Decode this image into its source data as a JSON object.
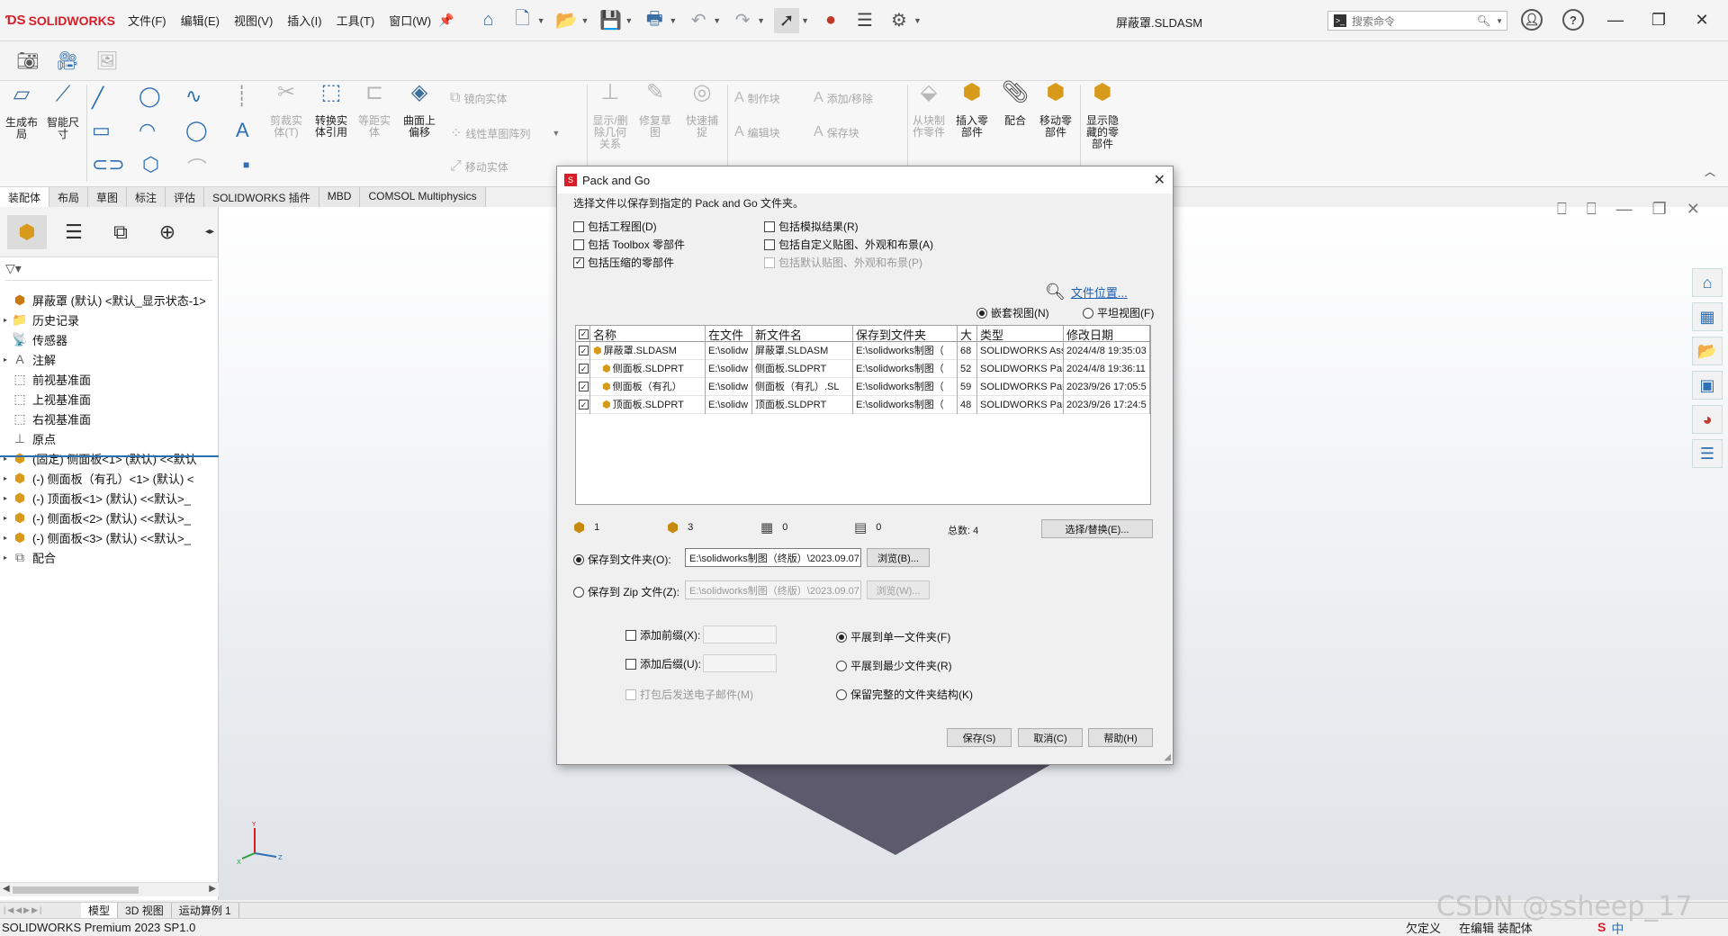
{
  "app": {
    "logo_text": "SOLIDWORKS",
    "document_title": "屏蔽罩.SLDASM",
    "brand_color": "#d71e28",
    "accent_color": "#2f6fb3"
  },
  "menu": [
    "文件(F)",
    "编辑(E)",
    "视图(V)",
    "插入(I)",
    "工具(T)",
    "窗口(W)"
  ],
  "search": {
    "placeholder": "搜索命令"
  },
  "ribbon": {
    "buttons": {
      "generate_layout": "生成布局",
      "smart_dim": "智能尺寸",
      "cut_entity": "剪裁实体(T)",
      "convert": "转换实体引用",
      "offset": "等距实体",
      "surface_offset": "曲面上偏移",
      "show_delete": "显示/删除几何关系",
      "repair_sketch": "修复草图",
      "quick_snap": "快速捕捉",
      "from_block": "从块制作零件",
      "insert_part": "插入零部件",
      "mate": "配合",
      "move_part": "移动零部件",
      "show_hidden": "显示隐藏的零部件"
    },
    "small": {
      "mirror": "镜向实体",
      "linear_pattern": "线性草图阵列",
      "move_entity": "移动实体",
      "make_block": "制作块",
      "edit_block": "编辑块",
      "add_remove": "添加/移除",
      "save_block": "保存块"
    }
  },
  "command_tabs": [
    "装配体",
    "布局",
    "草图",
    "标注",
    "评估",
    "SOLIDWORKS 插件",
    "MBD",
    "COMSOL Multiphysics"
  ],
  "tree": {
    "root": "屏蔽罩 (默认) <默认_显示状态-1>",
    "items": [
      {
        "label": "历史记录",
        "exp": true,
        "icon": "history-icon"
      },
      {
        "label": "传感器",
        "exp": false,
        "icon": "sensor-icon"
      },
      {
        "label": "注解",
        "exp": true,
        "icon": "annotation-icon"
      },
      {
        "label": "前视基准面",
        "exp": false,
        "icon": "plane-icon"
      },
      {
        "label": "上视基准面",
        "exp": false,
        "icon": "plane-icon"
      },
      {
        "label": "右视基准面",
        "exp": false,
        "icon": "plane-icon"
      },
      {
        "label": "原点",
        "exp": false,
        "icon": "origin-icon"
      },
      {
        "label": "(固定) 侧面板<1> (默认) <<默认",
        "exp": true,
        "icon": "part-icon"
      },
      {
        "label": "(-) 侧面板（有孔）<1> (默认) <",
        "exp": true,
        "icon": "part-icon"
      },
      {
        "label": "(-) 顶面板<1> (默认) <<默认>_",
        "exp": true,
        "icon": "part-icon"
      },
      {
        "label": "(-) 侧面板<2> (默认) <<默认>_",
        "exp": true,
        "icon": "part-icon"
      },
      {
        "label": "(-) 侧面板<3> (默认) <<默认>_",
        "exp": true,
        "icon": "part-icon"
      },
      {
        "label": "配合",
        "exp": true,
        "icon": "mate-icon"
      }
    ]
  },
  "dialog": {
    "title": "Pack and Go",
    "description": "选择文件以保存到指定的 Pack and Go 文件夹。",
    "options": {
      "include_drawings": {
        "label": "包括工程图(D)",
        "checked": false
      },
      "include_sim": {
        "label": "包括模拟结果(R)",
        "checked": false
      },
      "include_toolbox": {
        "label": "包括 Toolbox 零部件",
        "checked": false
      },
      "include_custom_decals": {
        "label": "包括自定义贴图、外观和布景(A)",
        "checked": false
      },
      "include_suppressed": {
        "label": "包括压缩的零部件",
        "checked": true
      },
      "include_default_decals": {
        "label": "包括默认贴图、外观和布景(P)",
        "checked": false
      }
    },
    "file_location_link": "文件位置...",
    "view_nested": "嵌套视图(N)",
    "view_flat": "平坦视图(F)",
    "table": {
      "headers": [
        "名称",
        "在文件",
        "新文件名",
        "保存到文件夹",
        "大",
        "类型",
        "修改日期"
      ],
      "rows": [
        {
          "name": "屏蔽罩.SLDASM",
          "in": "E:\\solidw",
          "newname": "屏蔽罩.SLDASM",
          "folder": "E:\\solidworks制图（",
          "size": "68",
          "type": "SOLIDWORKS Ass",
          "date": "2024/4/8 19:35:03",
          "indent": 0
        },
        {
          "name": "侧面板.SLDPRT",
          "in": "E:\\solidw",
          "newname": "侧面板.SLDPRT",
          "folder": "E:\\solidworks制图（",
          "size": "52",
          "type": "SOLIDWORKS Part",
          "date": "2024/4/8 19:36:11",
          "indent": 1
        },
        {
          "name": "侧面板（有孔）",
          "in": "E:\\solidw",
          "newname": "侧面板（有孔）.SL",
          "folder": "E:\\solidworks制图（",
          "size": "59",
          "type": "SOLIDWORKS Part",
          "date": "2023/9/26 17:05:5",
          "indent": 1
        },
        {
          "name": "顶面板.SLDPRT",
          "in": "E:\\solidw",
          "newname": "顶面板.SLDPRT",
          "folder": "E:\\solidworks制图（",
          "size": "48",
          "type": "SOLIDWORKS Part",
          "date": "2023/9/26 17:24:5",
          "indent": 1
        }
      ]
    },
    "counts": {
      "asm": "1",
      "parts": "3",
      "drawings": "0",
      "other": "0",
      "total": "总数: 4"
    },
    "select_replace": "选择/替换(E)...",
    "save_to_folder": "保存到文件夹(O):",
    "folder_path": "E:\\solidworks制图（终版）\\2023.09.07 课题",
    "browse": "浏览(B)...",
    "save_to_zip": "保存到 Zip 文件(Z):",
    "zip_path": "E:\\solidworks制图（终版）\\2023.09.07 课题",
    "browse_zip": "浏览(W)...",
    "add_prefix": "添加前缀(X):",
    "add_suffix": "添加后缀(U):",
    "email": "打包后发送电子邮件(M)",
    "flatten_single": "平展到单一文件夹(F)",
    "flatten_min": "平展到最少文件夹(R)",
    "keep_structure": "保留完整的文件夹结构(K)",
    "save_btn": "保存(S)",
    "cancel_btn": "取消(C)",
    "help_btn": "帮助(H)"
  },
  "bottom_tabs": [
    "模型",
    "3D 视图",
    "运动算例 1"
  ],
  "status": {
    "left": "SOLIDWORKS Premium 2023 SP1.0",
    "underdefined": "欠定义",
    "editing": "在编辑 装配体"
  },
  "watermark": "CSDN @ssheep_17",
  "tray": "中"
}
